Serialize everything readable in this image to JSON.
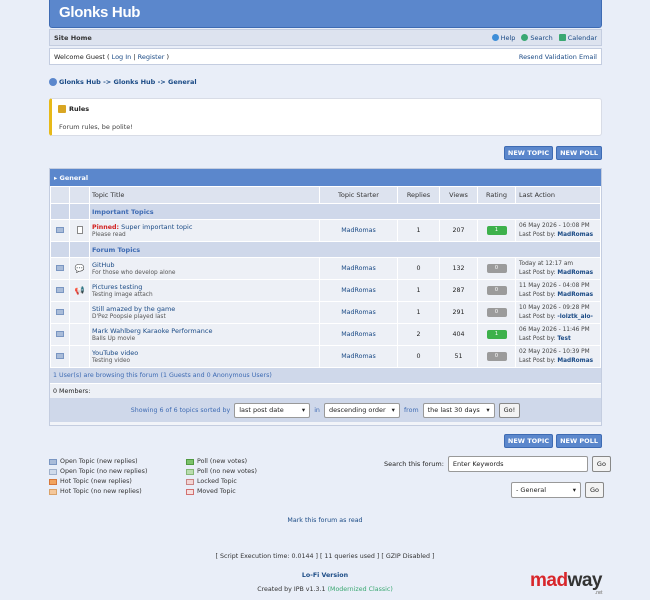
{
  "header": {
    "logo": "Glonks Hub"
  },
  "navbar": {
    "site_home": "Site Home",
    "help": "Help",
    "search": "Search",
    "calendar": "Calendar"
  },
  "userbar": {
    "welcome": "Welcome Guest ( ",
    "login": "Log In",
    "sep": " | ",
    "register": "Register",
    "close": " )",
    "resend": "Resend Validation Email"
  },
  "breadcrumb": "Glonks Hub -> Glonks Hub -> General",
  "rules": {
    "title": "Rules",
    "body": "Forum rules, be polite!"
  },
  "buttons": {
    "new_topic": "NEW TOPIC",
    "new_poll": "NEW POLL"
  },
  "forum": {
    "title": "General",
    "columns": [
      "Topic Title",
      "Topic Starter",
      "Replies",
      "Views",
      "Rating",
      "Last Action"
    ],
    "important_label": "Important Topics",
    "forum_topics_label": "Forum Topics",
    "pinned": {
      "prefix": "Pinned:",
      "title": " Super important topic",
      "desc": "Please read",
      "starter": "MadRomas",
      "replies": "1",
      "views": "207",
      "rating": "1",
      "date": "06 May 2026 - 10:08 PM",
      "lp_label": "Last Post by: ",
      "lp_user": "MadRomas"
    },
    "topics": [
      {
        "title": "GitHub",
        "desc": "For those who develop alone",
        "starter": "MadRomas",
        "replies": "0",
        "views": "132",
        "rating": "0",
        "date": "Today at 12:17 am",
        "lp_label": "Last Post by: ",
        "lp_user": "MadRomas"
      },
      {
        "title": "Pictures testing",
        "desc": "Testing image attach",
        "starter": "MadRomas",
        "replies": "1",
        "views": "287",
        "rating": "0",
        "date": "11 May 2026 - 04:08 PM",
        "lp_label": "Last Post by: ",
        "lp_user": "MadRomas"
      },
      {
        "title": "Still amazed by the game",
        "desc": "D'Pez Poopsie played last",
        "starter": "MadRomas",
        "replies": "1",
        "views": "291",
        "rating": "0",
        "date": "10 May 2026 - 09:28 PM",
        "lp_label": "Last Post by: ",
        "lp_user": "-lolztk_alo-"
      },
      {
        "title": "Mark Wahlberg Karaoke Performance",
        "desc": "Balls Up movie",
        "starter": "MadRomas",
        "replies": "2",
        "views": "404",
        "rating": "1",
        "date": "06 May 2026 - 11:46 PM",
        "lp_label": "Last Post by: ",
        "lp_user": "Test"
      },
      {
        "title": "YouTube video",
        "desc": "Testing video",
        "starter": "MadRomas",
        "replies": "0",
        "views": "51",
        "rating": "0",
        "date": "02 May 2026 - 10:39 PM",
        "lp_label": "Last Post by: ",
        "lp_user": "MadRomas"
      }
    ],
    "browsing": "1 User(s) are browsing this forum (1 Guests and 0 Anonymous Users)",
    "members": "0 Members:",
    "sort": {
      "showing": "Showing 6 of 6 topics sorted by",
      "sort_by": "last post date",
      "in": "in",
      "order": "descending order",
      "from": "from",
      "range": "the last 30 days",
      "go": "Go!"
    }
  },
  "legend": {
    "left": [
      "Open Topic (new replies)",
      "Open Topic (no new replies)",
      "Hot Topic (new replies)",
      "Hot Topic (no new replies)"
    ],
    "right": [
      "Poll (new votes)",
      "Poll (no new votes)",
      "Locked Topic",
      "Moved Topic"
    ]
  },
  "search": {
    "label": "Search this forum:",
    "placeholder": "Enter Keywords",
    "go": "Go"
  },
  "jump": {
    "value": "- General",
    "go": "Go"
  },
  "mark_read": "Mark this forum as read",
  "stats": "[ Script Execution time: 0.0144 ]   [ 11 queries used ]   [ GZIP Disabled ]",
  "lofi": "Lo-Fi Version",
  "credit": {
    "prefix": "Created by IPB v1.3.1 ",
    "suffix": "(Modernized Classic)"
  },
  "watermark": {
    "text_mad": "mad",
    "text_way": "way",
    "net": ".net"
  }
}
